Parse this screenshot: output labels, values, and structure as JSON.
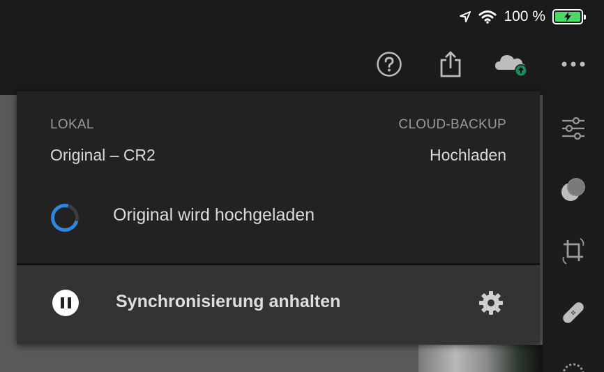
{
  "status_bar": {
    "location_icon": "location-arrow-icon",
    "wifi_icon": "wifi-icon",
    "battery_percent": "100 %",
    "battery_level": 1.0,
    "battery_state": "charging"
  },
  "toolbar": {
    "help_icon": "help-icon",
    "share_icon": "share-icon",
    "cloud_icon": "cloud-upload-icon",
    "more_icon": "more-icon"
  },
  "sync_panel": {
    "local_header": "LOKAL",
    "local_value": "Original – CR2",
    "cloud_header": "CLOUD-BACKUP",
    "cloud_value": "Hochladen",
    "upload_status": "Original wird hochgeladen",
    "pause_label": "Synchronisierung anhalten"
  },
  "right_rail": {
    "items": [
      "sliders-icon",
      "color-mix-icon",
      "crop-icon",
      "healing-bandage-icon",
      "dotted-circle-icon"
    ]
  },
  "colors": {
    "accent_blue": "#2d86e0",
    "cloud_badge_green": "#1f8a5a",
    "battery_green": "#4cd964"
  }
}
